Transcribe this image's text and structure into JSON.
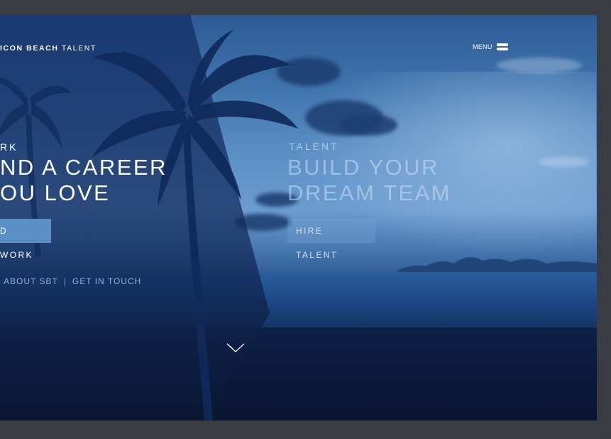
{
  "brand": {
    "logo_bold": "ICON BEACH",
    "logo_light": "TALENT"
  },
  "nav": {
    "menu_label": "MENU"
  },
  "work": {
    "eyebrow": "RK",
    "headline_line1": "ND A CAREER",
    "headline_line2": "OU LOVE",
    "cta_label": "D WORK"
  },
  "talent": {
    "eyebrow": "TALENT",
    "headline_line1": "BUILD YOUR",
    "headline_line2": "DREAM TEAM",
    "cta_label": "HIRE TALENT"
  },
  "footer_links": {
    "about": "ABOUT SBT",
    "separator": "|",
    "contact": "GET IN TOUCH"
  },
  "colors": {
    "frame": "#3b3b43",
    "work_button_bg": "#5b8fc6",
    "talent_text": "#cfe0f3",
    "link_text": "#8fb3d8"
  }
}
